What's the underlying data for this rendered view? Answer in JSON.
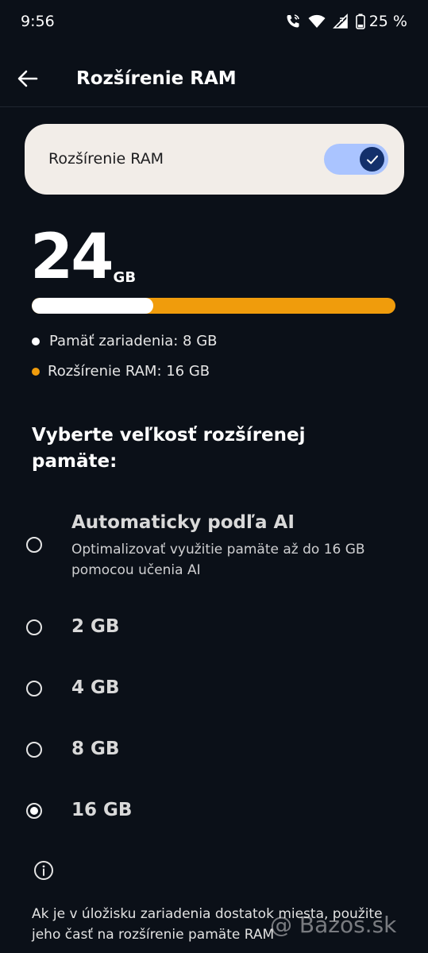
{
  "status_bar": {
    "time": "9:56",
    "battery": "25 %",
    "icons": [
      "wifi-call-icon",
      "wifi-icon",
      "signal-icon",
      "battery-icon"
    ]
  },
  "app_bar": {
    "back_icon": "back-arrow-icon",
    "title": "Rozšírenie RAM"
  },
  "toggle": {
    "label": "Rozšírenie RAM",
    "enabled": true
  },
  "memory": {
    "total_value": "24",
    "total_unit": "GB",
    "device_fraction": 0.333,
    "legend_device": "Pamäť zariadenia: 8 GB",
    "legend_extension": "Rozšírenie RAM: 16 GB",
    "device_color": "#ffffff",
    "extension_color": "#f09c0c"
  },
  "selection": {
    "title": "Vyberte veľkosť rozšírenej pamäte:",
    "options": [
      {
        "label": "Automaticky podľa AI",
        "description": "Optimalizovať využitie pamäte až do 16 GB pomocou učenia AI",
        "selected": false
      },
      {
        "label": "2 GB",
        "selected": false
      },
      {
        "label": "4 GB",
        "selected": false
      },
      {
        "label": "8 GB",
        "selected": false
      },
      {
        "label": "16 GB",
        "selected": true
      }
    ]
  },
  "info": {
    "icon": "info-icon",
    "text": "Ak je v úložisku zariadenia dostatok miesta, použite jeho časť na rozšírenie pamäte RAM"
  },
  "watermark": "@ Bazos.sk"
}
